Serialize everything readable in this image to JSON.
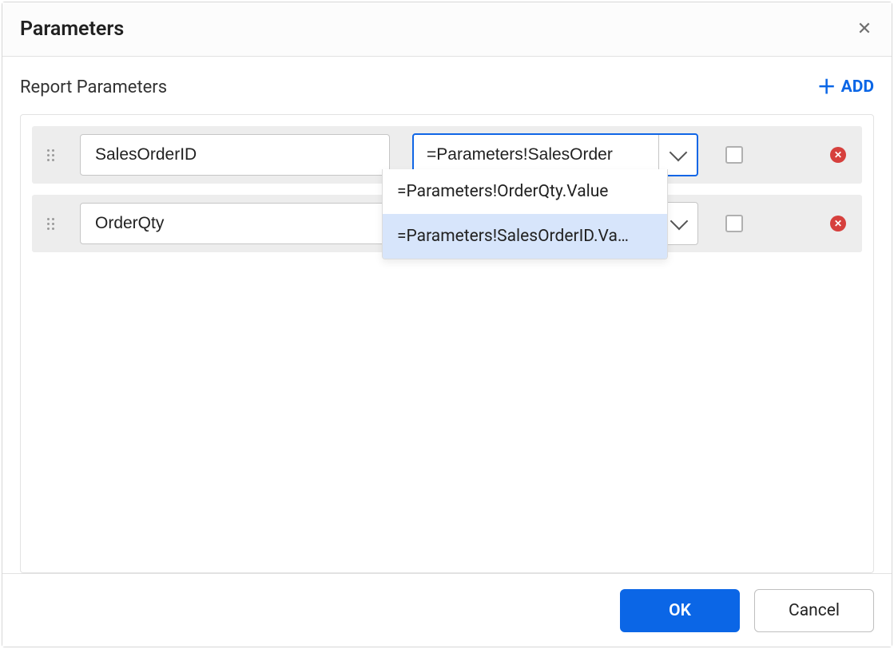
{
  "dialog": {
    "title": "Parameters",
    "section_title": "Report Parameters",
    "add_label": "ADD",
    "ok_label": "OK",
    "cancel_label": "Cancel"
  },
  "rows": [
    {
      "name": "SalesOrderID",
      "value": "=Parameters!SalesOrder",
      "checked": false,
      "focused": true
    },
    {
      "name": "OrderQty",
      "value": "",
      "checked": false,
      "focused": false
    }
  ],
  "dropdown": {
    "visible_for_row": 0,
    "options": [
      {
        "label": "=Parameters!OrderQty.Value",
        "selected": false
      },
      {
        "label": "=Parameters!SalesOrderID.Va…",
        "selected": true
      }
    ]
  }
}
